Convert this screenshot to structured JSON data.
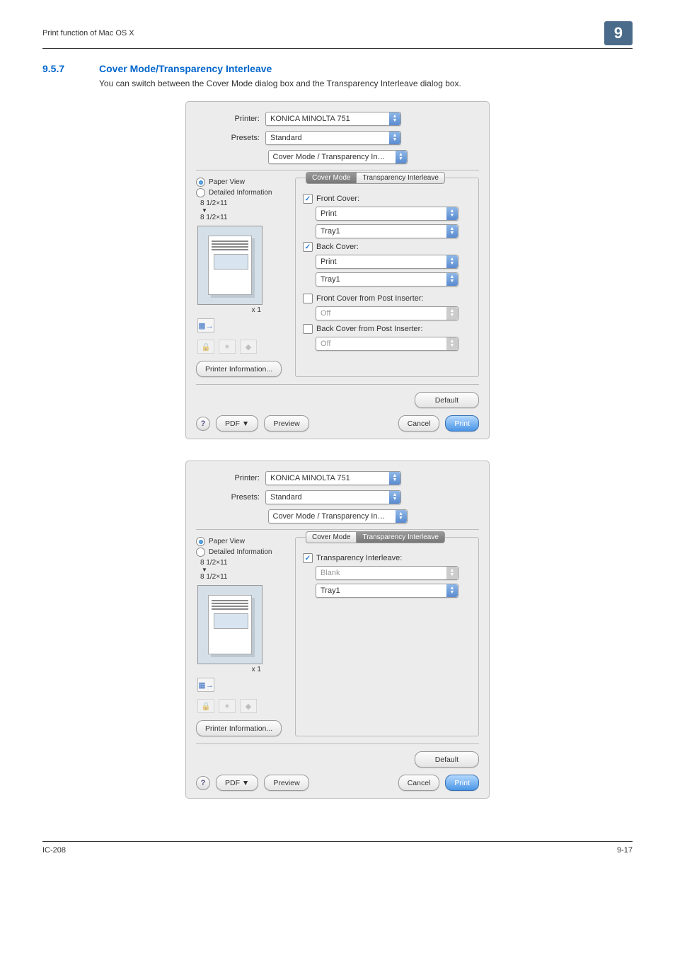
{
  "header": {
    "left": "Print function of Mac OS X",
    "chapter": "9"
  },
  "section": {
    "num": "9.5.7",
    "title": "Cover Mode/Transparency Interleave",
    "desc": "You can switch between the Cover Mode dialog box and the Transparency Interleave dialog box."
  },
  "common": {
    "printer_label": "Printer:",
    "printer_value": "KONICA MINOLTA 751",
    "presets_label": "Presets:",
    "presets_value": "Standard",
    "panel_select": "Cover Mode / Transparency In…",
    "paper_view": "Paper View",
    "detailed_info": "Detailed Information",
    "size_top": "8 1/2×11",
    "size_bottom": "8 1/2×11",
    "x1": "x 1",
    "printer_info_btn": "Printer Information...",
    "default_btn": "Default",
    "pdf_btn": "PDF ▼",
    "preview_btn": "Preview",
    "cancel_btn": "Cancel",
    "print_btn": "Print"
  },
  "dialog1": {
    "tab_cover": "Cover Mode",
    "tab_trans": "Transparency Interleave",
    "front_cover_label": "Front Cover:",
    "front_cover_mode": "Print",
    "front_cover_tray": "Tray1",
    "back_cover_label": "Back Cover:",
    "back_cover_mode": "Print",
    "back_cover_tray": "Tray1",
    "front_pi_label": "Front Cover from Post Inserter:",
    "front_pi_value": "Off",
    "back_pi_label": "Back Cover from Post Inserter:",
    "back_pi_value": "Off"
  },
  "dialog2": {
    "tab_cover": "Cover Mode",
    "tab_trans": "Transparency Interleave",
    "ti_label": "Transparency Interleave:",
    "ti_mode": "Blank",
    "ti_tray": "Tray1"
  },
  "footer": {
    "left": "IC-208",
    "right": "9-17"
  }
}
